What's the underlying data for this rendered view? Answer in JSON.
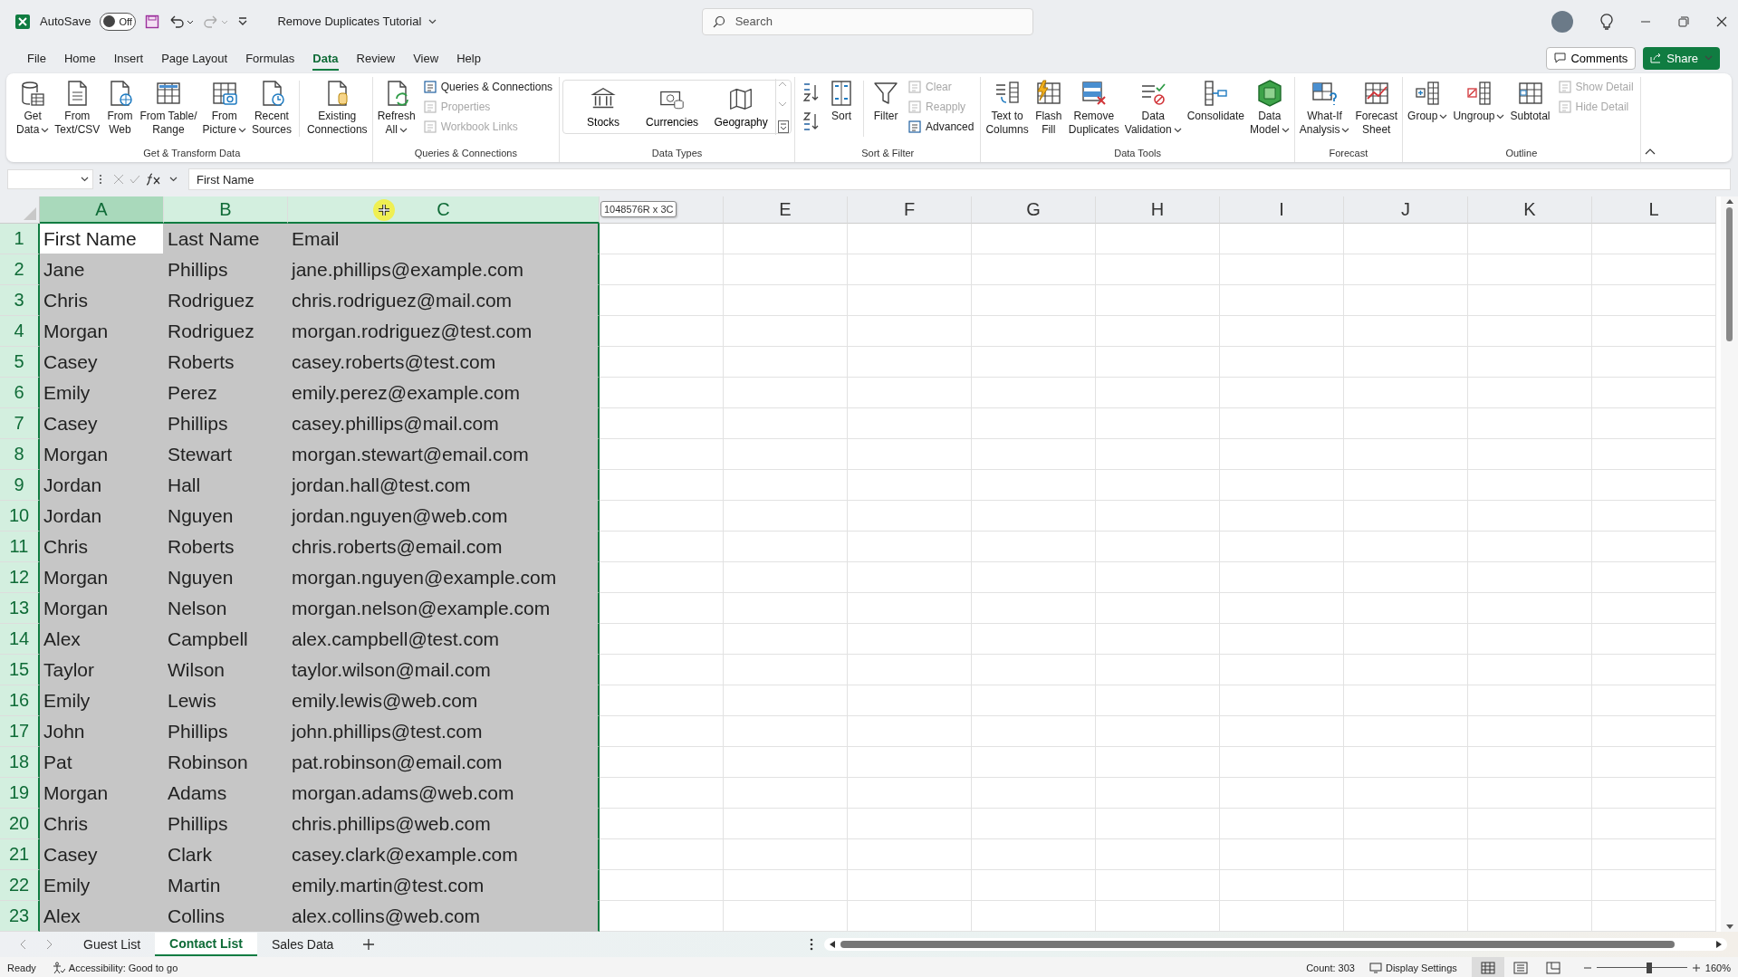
{
  "title_bar": {
    "autosave_label": "AutoSave",
    "autosave": {
      "on": false,
      "label": "Off"
    },
    "document_title": "Remove Duplicates Tutorial",
    "search": {
      "placeholder": "Search"
    }
  },
  "menu_tabs": [
    {
      "label": "File",
      "selected": false
    },
    {
      "label": "Home",
      "selected": false
    },
    {
      "label": "Insert",
      "selected": false
    },
    {
      "label": "Page Layout",
      "selected": false
    },
    {
      "label": "Formulas",
      "selected": false
    },
    {
      "label": "Data",
      "selected": true
    },
    {
      "label": "Review",
      "selected": false
    },
    {
      "label": "View",
      "selected": false
    },
    {
      "label": "Help",
      "selected": false
    }
  ],
  "comments_button": "Comments",
  "share_button": "Share",
  "ribbon": [
    {
      "label": "Get & Transform Data",
      "items": [
        {
          "kind": "large",
          "lines": [
            "Get",
            "Data"
          ],
          "dropdown": true
        },
        {
          "kind": "large",
          "lines": [
            "From",
            "Text/CSV"
          ],
          "dropdown": false
        },
        {
          "kind": "large",
          "lines": [
            "From",
            "Web"
          ],
          "dropdown": false
        },
        {
          "kind": "large",
          "lines": [
            "From Table/",
            "Range"
          ],
          "dropdown": false
        },
        {
          "kind": "large",
          "lines": [
            "From",
            "Picture"
          ],
          "dropdown": true
        },
        {
          "kind": "large",
          "lines": [
            "Recent",
            "Sources"
          ],
          "dropdown": false
        },
        {
          "kind": "separator"
        },
        {
          "kind": "large",
          "lines": [
            "Existing",
            "Connections"
          ],
          "dropdown": false
        }
      ]
    },
    {
      "label": "Queries & Connections",
      "items": [
        {
          "kind": "large",
          "lines": [
            "Refresh",
            "All"
          ],
          "dropdown": true
        },
        {
          "kind": "stack",
          "items": [
            {
              "label": "Queries & Connections",
              "disabled": false
            },
            {
              "label": "Properties",
              "disabled": true
            },
            {
              "label": "Workbook Links",
              "disabled": true
            }
          ]
        }
      ]
    },
    {
      "label": "Data Types",
      "items": [
        {
          "kind": "gallery",
          "items": [
            "Stocks",
            "Currencies",
            "Geography"
          ]
        }
      ]
    },
    {
      "label": "Sort & Filter",
      "items": [
        {
          "kind": "sort_pair"
        },
        {
          "kind": "large",
          "lines": [
            "Sort"
          ],
          "dropdown": false
        },
        {
          "kind": "separator"
        },
        {
          "kind": "large",
          "lines": [
            "Filter"
          ],
          "dropdown": false
        },
        {
          "kind": "stack",
          "items": [
            {
              "label": "Clear",
              "disabled": true
            },
            {
              "label": "Reapply",
              "disabled": true
            },
            {
              "label": "Advanced",
              "disabled": false
            }
          ]
        }
      ]
    },
    {
      "label": "Data Tools",
      "items": [
        {
          "kind": "large",
          "lines": [
            "Text to",
            "Columns"
          ],
          "dropdown": false
        },
        {
          "kind": "large",
          "lines": [
            "Flash",
            "Fill"
          ],
          "dropdown": false
        },
        {
          "kind": "large",
          "lines": [
            "Remove",
            "Duplicates"
          ],
          "dropdown": false
        },
        {
          "kind": "large",
          "lines": [
            "Data",
            "Validation"
          ],
          "dropdown": true
        },
        {
          "kind": "large",
          "lines": [
            "Consolidate"
          ],
          "dropdown": false
        },
        {
          "kind": "large",
          "lines": [
            "Data",
            "Model"
          ],
          "dropdown": true
        }
      ]
    },
    {
      "label": "Forecast",
      "items": [
        {
          "kind": "large",
          "lines": [
            "What-If",
            "Analysis"
          ],
          "dropdown": true
        },
        {
          "kind": "large",
          "lines": [
            "Forecast",
            "Sheet"
          ],
          "dropdown": false
        }
      ]
    },
    {
      "label": "Outline",
      "items": [
        {
          "kind": "large",
          "lines": [
            "Group"
          ],
          "dropdown": true
        },
        {
          "kind": "large",
          "lines": [
            "Ungroup"
          ],
          "dropdown": true
        },
        {
          "kind": "large",
          "lines": [
            "Subtotal"
          ],
          "dropdown": false
        },
        {
          "kind": "stack",
          "items": [
            {
              "label": "Show Detail",
              "disabled": true
            },
            {
              "label": "Hide Detail",
              "disabled": true
            }
          ]
        }
      ]
    }
  ],
  "formula_bar": {
    "value": "First Name"
  },
  "selection_tooltip": "1048576R x 3C",
  "columns": [
    {
      "label": "A",
      "selected": true,
      "active": true
    },
    {
      "label": "B",
      "selected": true,
      "active": false
    },
    {
      "label": "C",
      "selected": true,
      "active": false
    },
    {
      "selected": false,
      "active": false
    },
    {
      "label": "E",
      "selected": false,
      "active": false
    },
    {
      "label": "F",
      "selected": false,
      "active": false
    },
    {
      "label": "G",
      "selected": false,
      "active": false
    },
    {
      "label": "H",
      "selected": false,
      "active": false
    },
    {
      "label": "I",
      "selected": false,
      "active": false
    },
    {
      "label": "J",
      "selected": false,
      "active": false
    },
    {
      "label": "K",
      "selected": false,
      "active": false
    },
    {
      "label": "L",
      "selected": false,
      "active": false
    }
  ],
  "rows": [
    {
      "number": "1",
      "active": true,
      "cells": [
        "First Name",
        "Last Name",
        "Email"
      ]
    },
    {
      "number": "2",
      "active": false,
      "cells": [
        "Jane",
        "Phillips",
        "jane.phillips@example.com"
      ]
    },
    {
      "number": "3",
      "active": false,
      "cells": [
        "Chris",
        "Rodriguez",
        "chris.rodriguez@mail.com"
      ]
    },
    {
      "number": "4",
      "active": false,
      "cells": [
        "Morgan",
        "Rodriguez",
        "morgan.rodriguez@test.com"
      ]
    },
    {
      "number": "5",
      "active": false,
      "cells": [
        "Casey",
        "Roberts",
        "casey.roberts@test.com"
      ]
    },
    {
      "number": "6",
      "active": false,
      "cells": [
        "Emily",
        "Perez",
        "emily.perez@example.com"
      ]
    },
    {
      "number": "7",
      "active": false,
      "cells": [
        "Casey",
        "Phillips",
        "casey.phillips@mail.com"
      ]
    },
    {
      "number": "8",
      "active": false,
      "cells": [
        "Morgan",
        "Stewart",
        "morgan.stewart@email.com"
      ]
    },
    {
      "number": "9",
      "active": false,
      "cells": [
        "Jordan",
        "Hall",
        "jordan.hall@test.com"
      ]
    },
    {
      "number": "10",
      "active": false,
      "cells": [
        "Jordan",
        "Nguyen",
        "jordan.nguyen@web.com"
      ]
    },
    {
      "number": "11",
      "active": false,
      "cells": [
        "Chris",
        "Roberts",
        "chris.roberts@email.com"
      ]
    },
    {
      "number": "12",
      "active": false,
      "cells": [
        "Morgan",
        "Nguyen",
        "morgan.nguyen@example.com"
      ]
    },
    {
      "number": "13",
      "active": false,
      "cells": [
        "Morgan",
        "Nelson",
        "morgan.nelson@example.com"
      ]
    },
    {
      "number": "14",
      "active": false,
      "cells": [
        "Alex",
        "Campbell",
        "alex.campbell@test.com"
      ]
    },
    {
      "number": "15",
      "active": false,
      "cells": [
        "Taylor",
        "Wilson",
        "taylor.wilson@mail.com"
      ]
    },
    {
      "number": "16",
      "active": false,
      "cells": [
        "Emily",
        "Lewis",
        "emily.lewis@web.com"
      ]
    },
    {
      "number": "17",
      "active": false,
      "cells": [
        "John",
        "Phillips",
        "john.phillips@test.com"
      ]
    },
    {
      "number": "18",
      "active": false,
      "cells": [
        "Pat",
        "Robinson",
        "pat.robinson@email.com"
      ]
    },
    {
      "number": "19",
      "active": false,
      "cells": [
        "Morgan",
        "Adams",
        "morgan.adams@web.com"
      ]
    },
    {
      "number": "20",
      "active": false,
      "cells": [
        "Chris",
        "Phillips",
        "chris.phillips@web.com"
      ]
    },
    {
      "number": "21",
      "active": false,
      "cells": [
        "Casey",
        "Clark",
        "casey.clark@example.com"
      ]
    },
    {
      "number": "22",
      "active": false,
      "cells": [
        "Emily",
        "Martin",
        "emily.martin@test.com"
      ]
    },
    {
      "number": "23",
      "active": false,
      "cells": [
        "Alex",
        "Collins",
        "alex.collins@web.com"
      ]
    }
  ],
  "sheet_tabs": [
    {
      "label": "Guest List",
      "selected": false
    },
    {
      "label": "Contact List",
      "selected": true
    },
    {
      "label": "Sales Data",
      "selected": false
    }
  ],
  "status_bar": {
    "ready": "Ready",
    "accessibility": "Accessibility: Good to go",
    "count": "Count: 303",
    "display_settings": "Display Settings",
    "views": [
      {
        "selected": true
      },
      {
        "selected": false
      },
      {
        "selected": false
      }
    ],
    "zoom": {
      "level": 0.58,
      "label": "160%"
    }
  }
}
